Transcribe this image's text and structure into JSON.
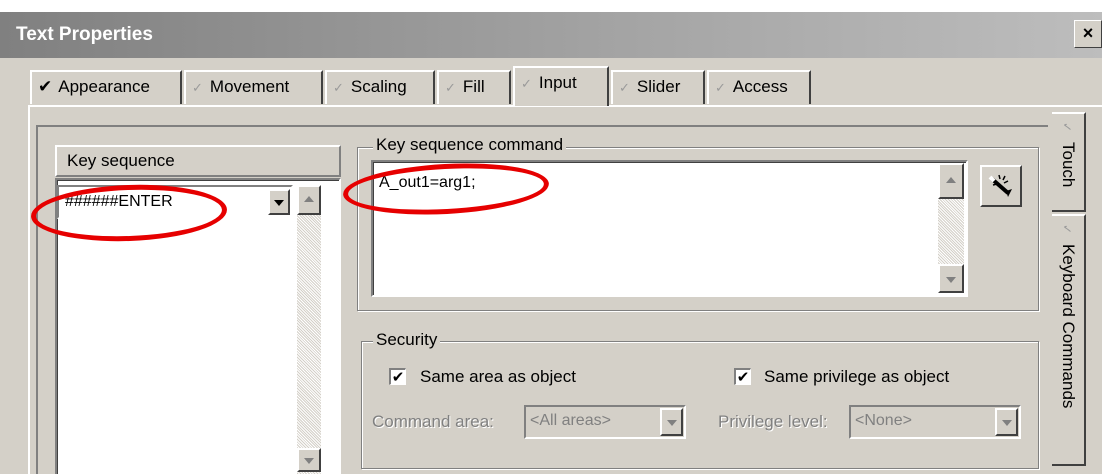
{
  "window": {
    "title": "Text Properties",
    "close_symbol": "×"
  },
  "tabs": [
    {
      "label": "Appearance",
      "checked": true
    },
    {
      "label": "Movement",
      "checked": false
    },
    {
      "label": "Scaling",
      "checked": false
    },
    {
      "label": "Fill",
      "checked": false
    },
    {
      "label": "Input",
      "checked": false,
      "active": true
    },
    {
      "label": "Slider",
      "checked": false
    },
    {
      "label": "Access",
      "checked": false
    }
  ],
  "tick_checked": "✔",
  "tick_unchecked": "✓",
  "side_tabs": [
    {
      "label": "Touch"
    },
    {
      "label": "Keyboard Commands",
      "active": true
    }
  ],
  "key_sequence": {
    "header": "Key sequence",
    "value": "######ENTER"
  },
  "command": {
    "label": "Key sequence command",
    "value": "A_out1=arg1;"
  },
  "security": {
    "label": "Security",
    "same_area_label": "Same area as object",
    "same_area_checked": true,
    "same_privilege_label": "Same privilege as object",
    "same_privilege_checked": true,
    "command_area_label": "Command area:",
    "command_area_value": "<All areas>",
    "privilege_label": "Privilege level:",
    "privilege_value": "<None>"
  },
  "check_mark": "✔",
  "highlight_color": "#e60000"
}
